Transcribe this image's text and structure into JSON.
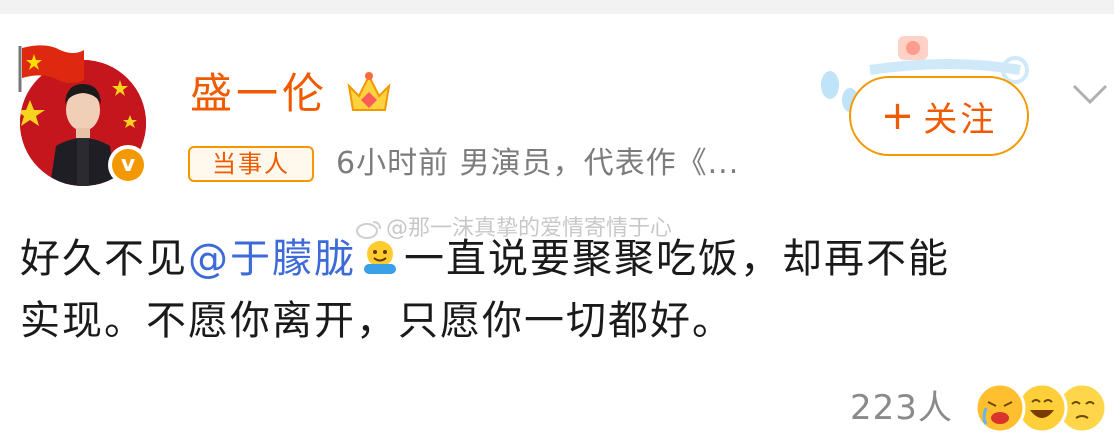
{
  "post": {
    "author_name": "盛一伦",
    "author_tag": "当事人",
    "time": "6小时前",
    "bio": "男演员，代表作《...",
    "follow_label": "关注",
    "follow_plus": "+",
    "text_prefix": "好久不见",
    "mention": "@于朦胧",
    "text_line1_rest": "一直说要聚聚吃饭，却再不能",
    "text_line2": "实现。不愿你离开，只愿你一切都好。",
    "watermark": "@那一沫真挚的爱情寄情于心",
    "reaction_count": "223人"
  },
  "icons": {
    "avatar": "avatar-portrait",
    "verified": "verified-v-badge-icon",
    "crown": "crown-icon",
    "flag": "china-flag-icon",
    "more": "chevron-down-icon",
    "emoji": "hug-emoji-icon",
    "reactions": [
      "crying-face-icon",
      "laughing-face-icon",
      "sad-face-icon"
    ]
  },
  "colors": {
    "accent": "#f05a00",
    "accent_border": "#f39800",
    "mention": "#3c6ad6",
    "muted": "#7c7c7c"
  }
}
